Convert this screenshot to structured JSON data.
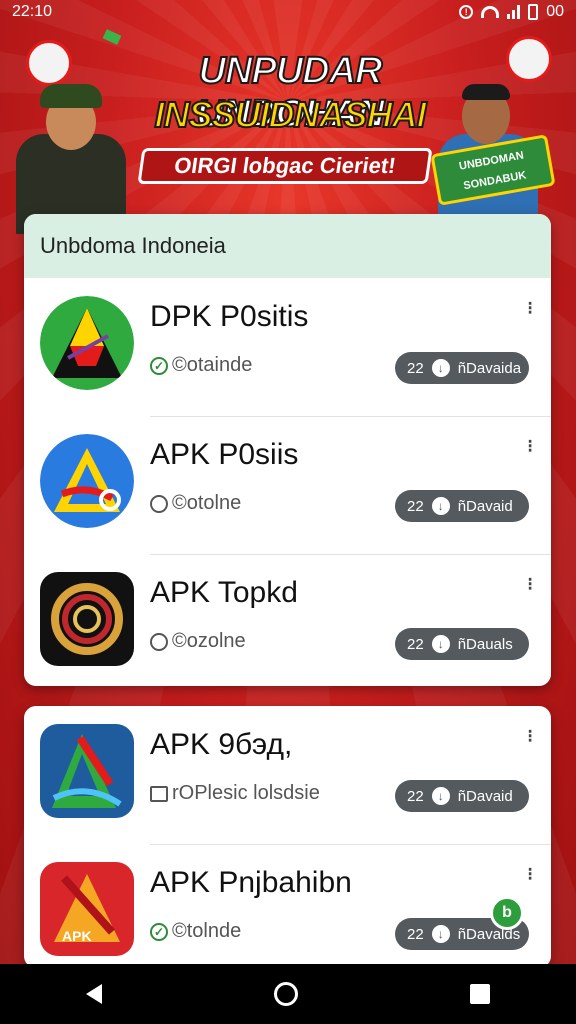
{
  "status_bar": {
    "time": "22:10",
    "battery_text": "00"
  },
  "banner": {
    "title_line_1": "UNPUDAR UNDOHAN",
    "title_line_2": "INSSUIDNASHAI",
    "subtitle": "OIRGI lobgac Cieriet!",
    "tag_line_1": "UNBDOMAN",
    "tag_line_2": "SONDABUK"
  },
  "colors": {
    "header_bg": "#d9efe4",
    "pill_bg": "#555a5e",
    "check_green": "#2e8b3a"
  },
  "card_1": {
    "header": "Unbdoma Indoneia",
    "apps": [
      {
        "name": "DPK P0sitis",
        "status": "©otainde",
        "status_icon": "check-icon",
        "count": "22",
        "download_label": "ñDavaida",
        "icon": "green-triangle-icon"
      },
      {
        "name": "APK P0siis",
        "status": "©otolne",
        "status_icon": "circle-icon",
        "count": "22",
        "download_label": "ñDavaid",
        "icon": "blue-a-icon"
      },
      {
        "name": "APK Topkd",
        "status": "©ozolne",
        "status_icon": "circle-icon",
        "count": "22",
        "download_label": "ñDauals",
        "icon": "gold-ring-icon"
      }
    ]
  },
  "card_2": {
    "apps": [
      {
        "name": "APK 9бэд,",
        "status": "rOPlesic lolsdsie",
        "status_icon": "doc-icon",
        "count": "22",
        "download_label": "ñDavaid",
        "icon": "blue-green-a-icon"
      },
      {
        "name": "APK Pnjbahibn",
        "status": "©tolnde",
        "status_icon": "check-icon",
        "count": "22",
        "download_label": "ñDavalds",
        "icon": "red-apk-icon",
        "icon_text": "APK"
      }
    ]
  }
}
